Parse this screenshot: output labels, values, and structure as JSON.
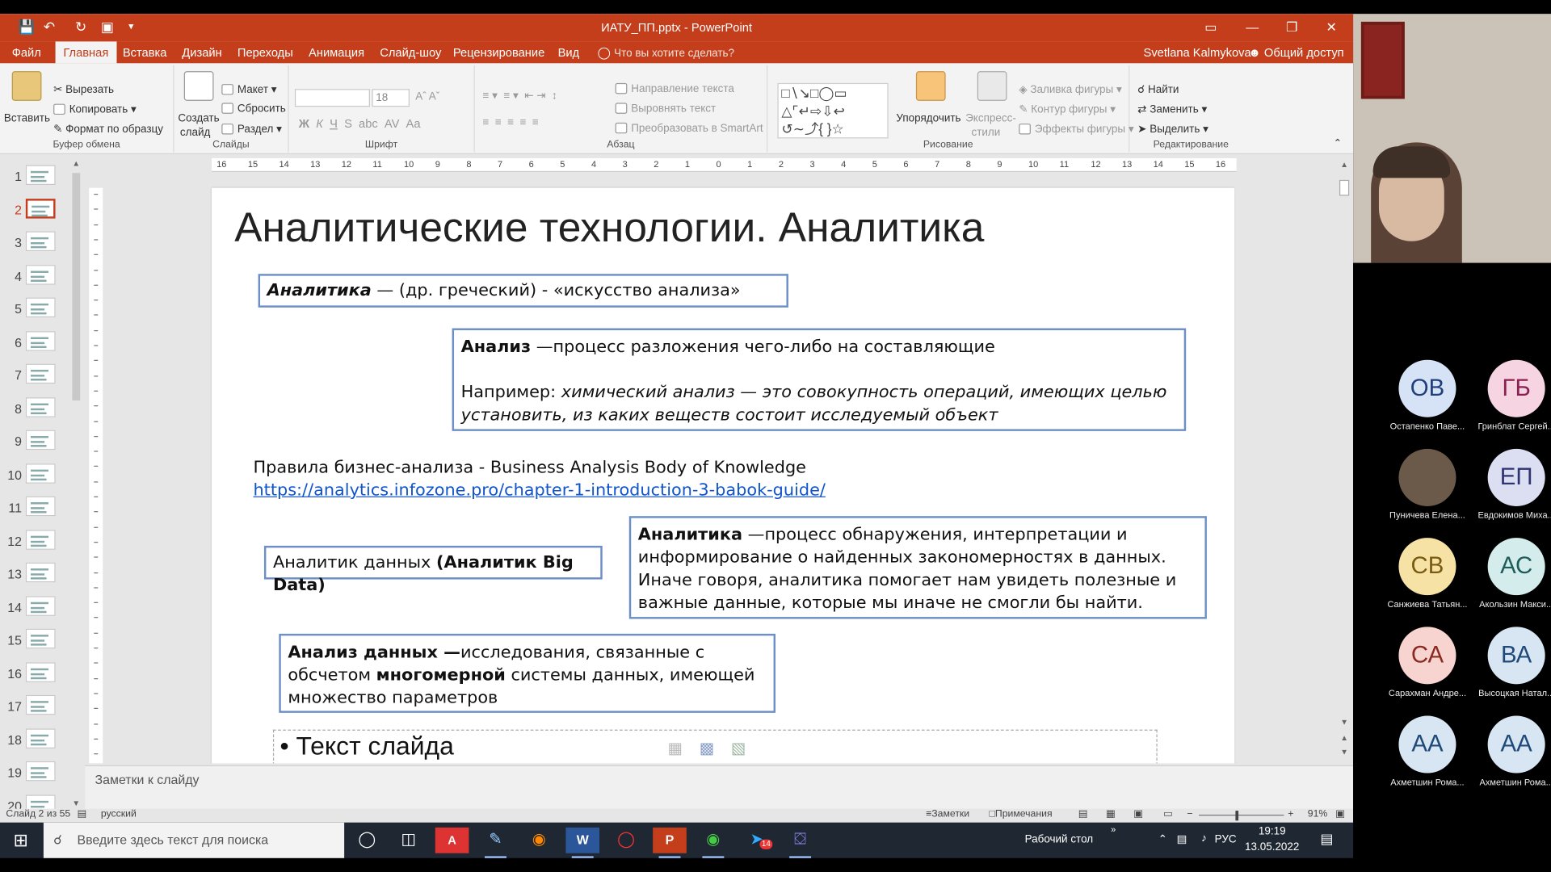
{
  "window": {
    "title": "ИАТУ_ПП.pptx - PowerPoint",
    "colors": {
      "accent": "#c43e1c",
      "ribbon_bg": "#f3f3f3",
      "box_border": "#6d8fc7",
      "link": "#1155cc"
    }
  },
  "tabs": {
    "file": "Файл",
    "home": "Главная",
    "insert": "Вставка",
    "design": "Дизайн",
    "transitions": "Переходы",
    "animations": "Анимация",
    "slideshow": "Слайд-шоу",
    "review": "Рецензирование",
    "view": "Вид",
    "tell_me": "Что вы хотите сделать?",
    "user": "Svetlana Kalmykova",
    "share": "Общий доступ"
  },
  "ribbon": {
    "paste": "Вставить",
    "cut": "Вырезать",
    "copy": "Копировать",
    "format_painter": "Формат по образцу",
    "clipboard": "Буфер обмена",
    "new_slide_1": "Создать",
    "new_slide_2": "слайд",
    "layout": "Макет",
    "reset": "Сбросить",
    "section": "Раздел",
    "slides": "Слайды",
    "font_size": "18",
    "font": "Шрифт",
    "text_direction": "Направление текста",
    "align_text": "Выровнять текст",
    "smartart": "Преобразовать в SmartArt",
    "paragraph": "Абзац",
    "arrange": "Упорядочить",
    "quick_styles_1": "Экспресс-",
    "quick_styles_2": "стили",
    "shape_fill": "Заливка фигуры",
    "shape_outline": "Контур фигуры",
    "shape_effects": "Эффекты фигуры",
    "drawing": "Рисование",
    "find": "Найти",
    "replace": "Заменить",
    "select": "Выделить",
    "editing": "Редактирование"
  },
  "thumbnails": [
    "1",
    "2",
    "3",
    "4",
    "5",
    "6",
    "7",
    "8",
    "9",
    "10",
    "11",
    "12",
    "13",
    "14",
    "15",
    "16",
    "17",
    "18",
    "19",
    "20"
  ],
  "ruler": [
    "16",
    "15",
    "14",
    "13",
    "12",
    "11",
    "10",
    "9",
    "8",
    "7",
    "6",
    "5",
    "4",
    "3",
    "2",
    "1",
    "0",
    "1",
    "2",
    "3",
    "4",
    "5",
    "6",
    "7",
    "8",
    "9",
    "10",
    "11",
    "12",
    "13",
    "14",
    "15",
    "16"
  ],
  "slide": {
    "title": "Аналитические технологии. Аналитика",
    "box1_term": "Аналитика",
    "box1_rest": " — (др. греческий) - «искусство анализа»",
    "box2_term": "Анализ",
    "box2_def": " —процесс разложения чего-либо на составляющие",
    "box2_example_label": "Например: ",
    "box2_example": "химический анализ — это совокупность операций, имеющих целью установить, из каких веществ состоит исследуемый объект",
    "rules_text": "Правила бизнес-анализа - Business Analysis Body of Knowledge ",
    "rules_link": "https://analytics.infozone.pro/chapter-1-introduction-3-babok-guide/",
    "box3_plain": "Аналитик данных ",
    "box3_bold": "(Аналитик Big Data)",
    "box4_term": "Аналитика",
    "box4_def": " —процесс обнаружения, интерпретации и информирование о найденных закономерностях в данных.  Иначе говоря, аналитика помогает нам увидеть полезные и важные данные, которые мы иначе не смогли бы найти.",
    "box5_term": "Анализ данных —",
    "box5_def1": "исследования, связанные с обсчетом ",
    "box5_bold": "многомерной",
    "box5_def2": " системы данных, имеющей множество параметров",
    "bullet_text": "Текст слайда"
  },
  "notes_placeholder": "Заметки к слайду",
  "status": {
    "slide_of": "Слайд 2 из 55",
    "language": "русский",
    "notes": "Заметки",
    "comments": "Примечания",
    "zoom": "91%"
  },
  "participants": [
    {
      "initials": "ОВ",
      "name": "Остапенко Паве...",
      "bg": "#d6e3f7",
      "fg": "#1f3f7a"
    },
    {
      "initials": "ГБ",
      "name": "Гринблат Сергей...",
      "bg": "#f6d4e2",
      "fg": "#8a2050"
    },
    {
      "initials": "",
      "name": "Пуничева Елена...",
      "bg": "#6b5a4a",
      "fg": "#ffffff"
    },
    {
      "initials": "ЕП",
      "name": "Евдокимов Миха...",
      "bg": "#dcdff2",
      "fg": "#2d3470"
    },
    {
      "initials": "СВ",
      "name": "Санжиева Татьян...",
      "bg": "#f7e2a6",
      "fg": "#7a5a10"
    },
    {
      "initials": "АС",
      "name": "Акользин Макси...",
      "bg": "#d4eceb",
      "fg": "#1d5c58"
    },
    {
      "initials": "СА",
      "name": "Сарахман Андре...",
      "bg": "#f7d4d0",
      "fg": "#8a2a20"
    },
    {
      "initials": "ВА",
      "name": "Высоцкая Натал...",
      "bg": "#d8e6f4",
      "fg": "#1f4a78"
    },
    {
      "initials": "АА",
      "name": "Ахметшин Рома...",
      "bg": "#d8e6f4",
      "fg": "#1f4a78"
    },
    {
      "initials": "АА",
      "name": "Ахметшин Рома...",
      "bg": "#d8e6f4",
      "fg": "#1f4a78"
    }
  ],
  "taskbar": {
    "search_placeholder": "Введите здесь текст для поиска",
    "desktop": "Рабочий стол",
    "lang": "РУС",
    "time": "19:19",
    "date": "13.05.2022",
    "badge": "14"
  }
}
